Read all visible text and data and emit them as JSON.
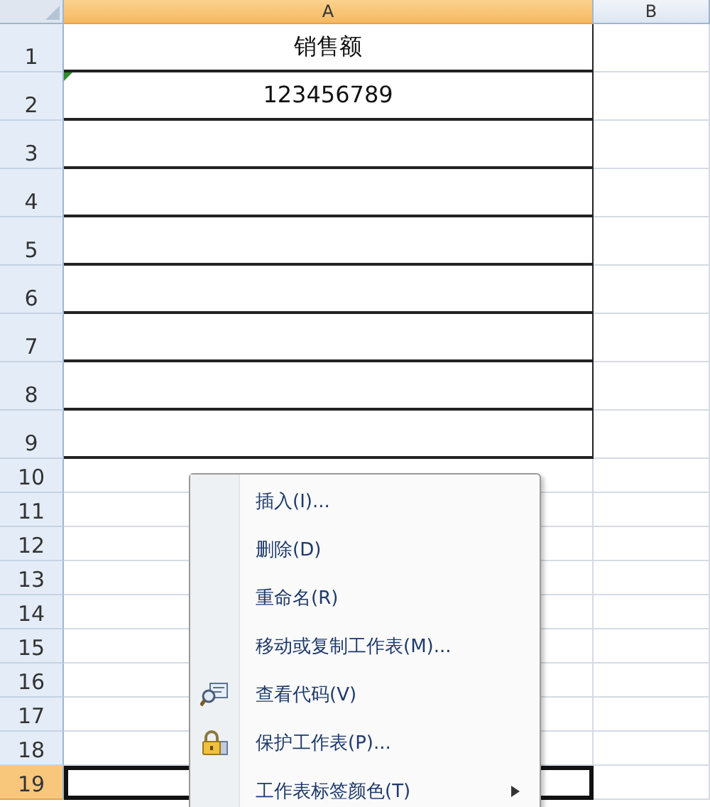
{
  "columns": [
    {
      "label": "A",
      "selected": true
    },
    {
      "label": "B",
      "selected": false
    }
  ],
  "rows": [
    {
      "number": "1",
      "selected": false,
      "bordered": true,
      "cells": [
        {
          "text": "销售额",
          "flagged": false,
          "active": false
        },
        {
          "text": "",
          "flagged": false,
          "active": false
        }
      ]
    },
    {
      "number": "2",
      "selected": false,
      "bordered": true,
      "cells": [
        {
          "text": "123456789",
          "flagged": true,
          "active": false
        },
        {
          "text": "",
          "flagged": false,
          "active": false
        }
      ]
    },
    {
      "number": "3",
      "selected": false,
      "bordered": true,
      "cells": [
        {
          "text": "",
          "flagged": false,
          "active": false
        },
        {
          "text": "",
          "flagged": false,
          "active": false
        }
      ]
    },
    {
      "number": "4",
      "selected": false,
      "bordered": true,
      "cells": [
        {
          "text": "",
          "flagged": false,
          "active": false
        },
        {
          "text": "",
          "flagged": false,
          "active": false
        }
      ]
    },
    {
      "number": "5",
      "selected": false,
      "bordered": true,
      "cells": [
        {
          "text": "",
          "flagged": false,
          "active": false
        },
        {
          "text": "",
          "flagged": false,
          "active": false
        }
      ]
    },
    {
      "number": "6",
      "selected": false,
      "bordered": true,
      "cells": [
        {
          "text": "",
          "flagged": false,
          "active": false
        },
        {
          "text": "",
          "flagged": false,
          "active": false
        }
      ]
    },
    {
      "number": "7",
      "selected": false,
      "bordered": true,
      "cells": [
        {
          "text": "",
          "flagged": false,
          "active": false
        },
        {
          "text": "",
          "flagged": false,
          "active": false
        }
      ]
    },
    {
      "number": "8",
      "selected": false,
      "bordered": true,
      "cells": [
        {
          "text": "",
          "flagged": false,
          "active": false
        },
        {
          "text": "",
          "flagged": false,
          "active": false
        }
      ]
    },
    {
      "number": "9",
      "selected": false,
      "bordered": true,
      "cells": [
        {
          "text": "",
          "flagged": false,
          "active": false
        },
        {
          "text": "",
          "flagged": false,
          "active": false
        }
      ]
    },
    {
      "number": "10",
      "selected": false,
      "bordered": false,
      "cells": [
        {
          "text": "",
          "flagged": false,
          "active": false
        },
        {
          "text": "",
          "flagged": false,
          "active": false
        }
      ]
    },
    {
      "number": "11",
      "selected": false,
      "bordered": false,
      "cells": [
        {
          "text": "",
          "flagged": false,
          "active": false
        },
        {
          "text": "",
          "flagged": false,
          "active": false
        }
      ]
    },
    {
      "number": "12",
      "selected": false,
      "bordered": false,
      "cells": [
        {
          "text": "",
          "flagged": false,
          "active": false
        },
        {
          "text": "",
          "flagged": false,
          "active": false
        }
      ]
    },
    {
      "number": "13",
      "selected": false,
      "bordered": false,
      "cells": [
        {
          "text": "",
          "flagged": false,
          "active": false
        },
        {
          "text": "",
          "flagged": false,
          "active": false
        }
      ]
    },
    {
      "number": "14",
      "selected": false,
      "bordered": false,
      "cells": [
        {
          "text": "",
          "flagged": false,
          "active": false
        },
        {
          "text": "",
          "flagged": false,
          "active": false
        }
      ]
    },
    {
      "number": "15",
      "selected": false,
      "bordered": false,
      "cells": [
        {
          "text": "",
          "flagged": false,
          "active": false
        },
        {
          "text": "",
          "flagged": false,
          "active": false
        }
      ]
    },
    {
      "number": "16",
      "selected": false,
      "bordered": false,
      "cells": [
        {
          "text": "",
          "flagged": false,
          "active": false
        },
        {
          "text": "",
          "flagged": false,
          "active": false
        }
      ]
    },
    {
      "number": "17",
      "selected": false,
      "bordered": false,
      "cells": [
        {
          "text": "",
          "flagged": false,
          "active": false
        },
        {
          "text": "",
          "flagged": false,
          "active": false
        }
      ]
    },
    {
      "number": "18",
      "selected": false,
      "bordered": false,
      "cells": [
        {
          "text": "",
          "flagged": false,
          "active": false
        },
        {
          "text": "",
          "flagged": false,
          "active": false
        }
      ]
    },
    {
      "number": "19",
      "selected": true,
      "bordered": false,
      "cells": [
        {
          "text": "",
          "flagged": false,
          "active": true
        },
        {
          "text": "",
          "flagged": false,
          "active": false
        }
      ]
    }
  ],
  "context_menu": [
    {
      "label": "插入(I)...",
      "kind": "plain",
      "submenu": false
    },
    {
      "label": "删除(D)",
      "kind": "plain",
      "submenu": false
    },
    {
      "label": "重命名(R)",
      "kind": "plain",
      "submenu": false
    },
    {
      "label": "移动或复制工作表(M)...",
      "kind": "plain",
      "submenu": false
    },
    {
      "label": "查看代码(V)",
      "kind": "code",
      "submenu": false
    },
    {
      "label": "保护工作表(P)...",
      "kind": "lock",
      "submenu": false
    },
    {
      "label": "工作表标签颜色(T)",
      "kind": "plain",
      "submenu": true
    }
  ]
}
